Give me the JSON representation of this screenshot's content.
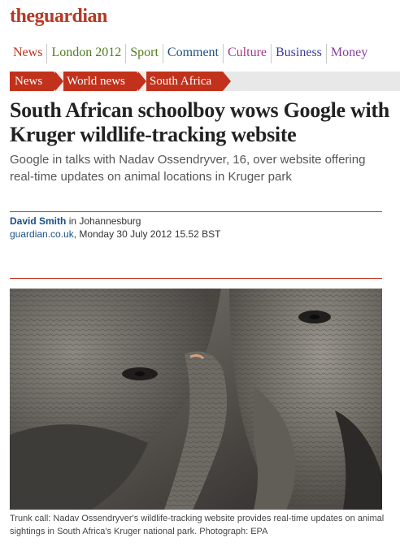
{
  "logo": {
    "the": "the",
    "name": "guardian"
  },
  "sections": [
    {
      "label": "News",
      "color": "#c1311b"
    },
    {
      "label": "London 2012",
      "color": "#4f7e1c"
    },
    {
      "label": "Sport",
      "color": "#4f7e1c"
    },
    {
      "label": "Comment",
      "color": "#1a4f86"
    },
    {
      "label": "Culture",
      "color": "#a43789"
    },
    {
      "label": "Business",
      "color": "#3c3c9b"
    },
    {
      "label": "Money",
      "color": "#8a3ca0"
    }
  ],
  "breadcrumbs": [
    "News",
    "World news",
    "South Africa"
  ],
  "article": {
    "headline": "South African schoolboy wows Google with Kruger wildlife-tracking website",
    "standfirst": "Google in talks with Nadav Ossendryver, 16, over website offering real-time updates on animal locations in Kruger park",
    "author": "David Smith",
    "author_location": " in Johannesburg",
    "source": "guardian.co.uk",
    "date": ", Monday 30 July 2012 15.52 BST",
    "caption": "Trunk call: Nadav Ossendryver's wildlife-tracking website provides real-time updates on animal sightings in South Africa's Kruger national park. Photograph: EPA"
  },
  "colors": {
    "brand": "#c1311b",
    "link": "#1a4f86"
  }
}
